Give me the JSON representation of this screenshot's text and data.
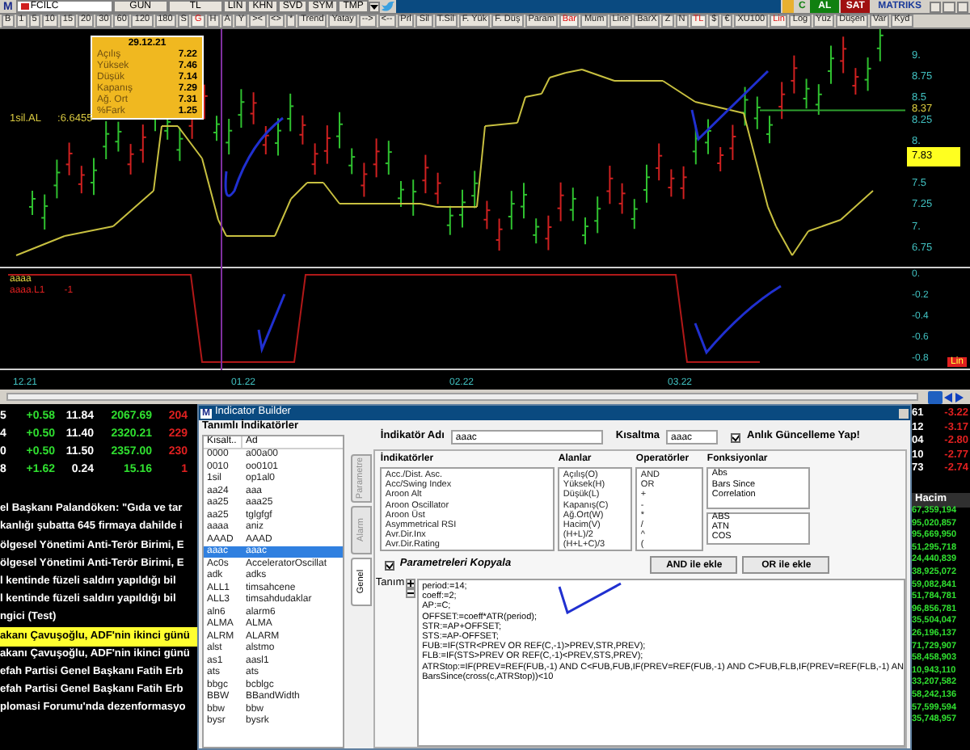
{
  "chart_window": {
    "logo": "M",
    "symbol": "FCILC",
    "top_buttons": [
      "GUN",
      "TL",
      "LIN",
      "KHN",
      "SVD",
      "SYM",
      "TMP"
    ],
    "trade_buttons": [
      {
        "label": "C",
        "kind": "neutral"
      },
      {
        "label": "AL",
        "kind": "buy"
      },
      {
        "label": "SAT",
        "kind": "sell"
      }
    ],
    "brand": "MATRIKS",
    "toolbar": [
      {
        "label": "B",
        "selected": false
      },
      {
        "label": "1",
        "selected": false
      },
      {
        "label": "5",
        "selected": false
      },
      {
        "label": "10",
        "selected": false
      },
      {
        "label": "15",
        "selected": false
      },
      {
        "label": "20",
        "selected": false
      },
      {
        "label": "30",
        "selected": false
      },
      {
        "label": "60",
        "selected": false
      },
      {
        "label": "120",
        "selected": false
      },
      {
        "label": "180",
        "selected": false
      },
      {
        "label": "S",
        "selected": false
      },
      {
        "label": "G",
        "selected": true
      },
      {
        "label": "H",
        "selected": false
      },
      {
        "label": "A",
        "selected": false
      },
      {
        "label": "Y",
        "selected": false
      },
      {
        "label": "><",
        "selected": false
      },
      {
        "label": "<>",
        "selected": false
      },
      {
        "label": "*",
        "selected": false
      },
      {
        "label": "Trend",
        "selected": false
      },
      {
        "label": "Yatay",
        "selected": false
      },
      {
        "label": "-->",
        "selected": false
      },
      {
        "label": "<--",
        "selected": false
      },
      {
        "label": "Prl",
        "selected": false
      },
      {
        "label": "Sil",
        "selected": false
      },
      {
        "label": "T.Sil",
        "selected": false
      },
      {
        "label": "F. Yük",
        "selected": false
      },
      {
        "label": "F. Düş",
        "selected": false
      },
      {
        "label": "Param",
        "selected": false
      },
      {
        "label": "Bar",
        "selected": true
      },
      {
        "label": "Mum",
        "selected": false
      },
      {
        "label": "Line",
        "selected": false
      },
      {
        "label": "BarX",
        "selected": false
      },
      {
        "label": "Z",
        "selected": false
      },
      {
        "label": "N",
        "selected": false
      },
      {
        "label": "TL",
        "selected": true
      },
      {
        "label": "$",
        "selected": false
      },
      {
        "label": "€",
        "selected": false
      },
      {
        "label": "XU100",
        "selected": false
      },
      {
        "label": "Lin",
        "selected": true
      },
      {
        "label": "Log",
        "selected": false
      },
      {
        "label": "Yüz",
        "selected": false
      },
      {
        "label": "Düşen",
        "selected": false
      },
      {
        "label": "Var",
        "selected": false
      },
      {
        "label": "Kyd",
        "selected": false
      }
    ],
    "tooltip": {
      "date": "29.12.21",
      "rows": [
        {
          "label": "Açılış",
          "value": "7.22"
        },
        {
          "label": "Yüksek",
          "value": "7.46"
        },
        {
          "label": "Düşük",
          "value": "7.14"
        },
        {
          "label": "Kapanış",
          "value": "7.29"
        },
        {
          "label": "Ağ. Ort",
          "value": "7.31"
        },
        {
          "label": "%Fark",
          "value": "1.25"
        }
      ]
    },
    "legend": {
      "label": "1sil.AL",
      "value": ":6.6455"
    },
    "price_axis": [
      "9.",
      "8.75",
      "8.5",
      "8.25",
      "8.",
      "7.5",
      "7.25",
      "7.",
      "6.75"
    ],
    "last_price": "8.37",
    "current_price": "7.83",
    "indicator_pane": {
      "legend": [
        {
          "label": "aaaa",
          "color": "#e0d040"
        },
        {
          "label": "aaaa.L1",
          "value": "-1",
          "color": "#e02020"
        }
      ],
      "axis": [
        "0.",
        "-0.2",
        "-0.4",
        "-0.6",
        "-0.8"
      ],
      "scale": "Lin"
    },
    "time_axis": [
      "12.21",
      "01.22",
      "02.22",
      "03.22"
    ]
  },
  "market_rows": [
    {
      "cells": [
        "5",
        "+0.58",
        "11.84",
        "2067.69",
        "204"
      ]
    },
    {
      "cells": [
        "4",
        "+0.50",
        "11.40",
        "2320.21",
        "229"
      ]
    },
    {
      "cells": [
        "0",
        "+0.50",
        "11.50",
        "2357.00",
        "230"
      ]
    },
    {
      "cells": [
        "8",
        "+1.62",
        "0.24",
        "15.16",
        "1"
      ]
    }
  ],
  "right_rows": [
    {
      "code": "61",
      "change": "-3.22"
    },
    {
      "code": "12",
      "change": "-3.17"
    },
    {
      "code": "04",
      "change": "-2.80"
    },
    {
      "code": "10",
      "change": "-2.77"
    },
    {
      "code": "73",
      "change": "-2.74"
    }
  ],
  "news": [
    {
      "text": "el Başkanı Palandöken: \"Gıda ve tar",
      "selected": false
    },
    {
      "text": "kanlığı şubatta 645 firmaya dahilde i",
      "selected": false
    },
    {
      "text": "ölgesel Yönetimi Anti-Terör Birimi, E",
      "selected": false
    },
    {
      "text": "ölgesel Yönetimi Anti-Terör Birimi, E",
      "selected": false
    },
    {
      "text": "l kentinde füzeli saldırı yapıldığı bil",
      "selected": false
    },
    {
      "text": "l kentinde füzeli saldırı yapıldığı bil",
      "selected": false
    },
    {
      "text": "ngici (Test)",
      "selected": false
    },
    {
      "text": "akanı Çavuşoğlu, ADF'nin ikinci günü",
      "selected": true
    },
    {
      "text": "akanı Çavuşoğlu, ADF'nin ikinci günü",
      "selected": false
    },
    {
      "text": "efah Partisi Genel Başkanı Fatih Erb",
      "selected": false
    },
    {
      "text": "efah Partisi Genel Başkanı Fatih Erb",
      "selected": false
    },
    {
      "text": "plomasi Forumu'nda dezenformasyo",
      "selected": false
    }
  ],
  "volume": {
    "header": "Hacim",
    "values": [
      "67,359,194",
      "95,020,857",
      "95,669,950",
      "51,295,718",
      "24,440,839",
      "38,925,072",
      "59,082,841",
      "51,784,781",
      "96,856,781",
      "35,504,047",
      "26,196,137",
      "71,729,907",
      "58,458,903",
      "10,943,110",
      "33,207,582",
      "58,242,136",
      "57,599,594",
      "35,748,957"
    ]
  },
  "dialog": {
    "logo": "M",
    "title": "Indicator Builder",
    "group_title": "Tanımlı İndikatörler",
    "columns": [
      "Kısalt..",
      "Ad"
    ],
    "rows": [
      {
        "code": "0000",
        "name": "a00a00",
        "selected": false
      },
      {
        "code": "0010",
        "name": "oo0101",
        "selected": false
      },
      {
        "code": "1sil",
        "name": "op1al0",
        "selected": false
      },
      {
        "code": "aa24",
        "name": "aaa",
        "selected": false
      },
      {
        "code": "aa25",
        "name": "aaa25",
        "selected": false
      },
      {
        "code": "aa25",
        "name": "tglgfgf",
        "selected": false
      },
      {
        "code": "aaaa",
        "name": "aniz",
        "selected": false
      },
      {
        "code": "AAAD",
        "name": "AAAD",
        "selected": false
      },
      {
        "code": "aaac",
        "name": "aaac",
        "selected": true
      },
      {
        "code": "Ac0s",
        "name": "AcceleratorOscillat",
        "selected": false
      },
      {
        "code": "adk",
        "name": "adks",
        "selected": false
      },
      {
        "code": "ALL1",
        "name": "timsahcene",
        "selected": false
      },
      {
        "code": "ALL3",
        "name": "timsahdudaklar",
        "selected": false
      },
      {
        "code": "aln6",
        "name": "alarm6",
        "selected": false
      },
      {
        "code": "ALMA",
        "name": "ALMA",
        "selected": false
      },
      {
        "code": "ALRM",
        "name": "ALARM",
        "selected": false
      },
      {
        "code": "alst",
        "name": "alstmo",
        "selected": false
      },
      {
        "code": "as1",
        "name": "aasl1",
        "selected": false
      },
      {
        "code": "ats",
        "name": "ats",
        "selected": false
      },
      {
        "code": "bbgc",
        "name": "bcblgc",
        "selected": false
      },
      {
        "code": "BBW",
        "name": "BBandWidth",
        "selected": false
      },
      {
        "code": "bbw",
        "name": "bbw",
        "selected": false
      },
      {
        "code": "bysr",
        "name": "bysrk",
        "selected": false
      }
    ],
    "tabs": [
      {
        "label": "Parametre",
        "selected": false
      },
      {
        "label": "Alarm",
        "selected": false
      },
      {
        "label": "Genel",
        "selected": true
      }
    ],
    "name_label": "İndikatör Adı",
    "name_value": "aaac",
    "short_label": "Kısaltma",
    "short_value": "aaac",
    "live_update": {
      "label": "Anlık Güncelleme Yap!",
      "checked": true
    },
    "lists": [
      {
        "title": "İndikatörler",
        "items": [
          "Acc./Dist. Asc.",
          "Acc/Swing Index",
          "Aroon Alt",
          "Aroon Oscillator",
          "Aroon Üst",
          "Asymmetrical RSI",
          "Avr.Dir.Inx",
          "Avr.Dir.Rating"
        ]
      },
      {
        "title": "Alanlar",
        "items": [
          "Açılış(O)",
          "Yüksek(H)",
          "Düşük(L)",
          "Kapanış(C)",
          "Ağ.Ort(W)",
          "Hacim(V)",
          "(H+L)/2",
          "(H+L+C)/3"
        ]
      },
      {
        "title": "Operatörler",
        "items": [
          "AND",
          "OR",
          "+",
          "-",
          "*",
          "/",
          "^",
          "("
        ]
      }
    ],
    "functions": {
      "title": "Fonksiyonlar",
      "items": [
        "Abs",
        "Bars Since",
        "Correlation"
      ],
      "items2": [
        "ABS",
        "ATN",
        "COS"
      ]
    },
    "copy_params": {
      "label": "Parametreleri Kopyala",
      "checked": true
    },
    "buttons": [
      "AND ile ekle",
      "OR ile ekle"
    ],
    "definition_label": "Tanım",
    "code": [
      "period:=14;",
      "coeff:=2;",
      "AP:=C;",
      "OFFSET:=coeff*ATR(period);",
      "STR:=AP+OFFSET;",
      "STS:=AP-OFFSET;",
      "FUB:=IF(STR<PREV OR REF(C,-1)>PREV,STR,PREV);",
      "FLB:=IF(STS>PREV OR REF(C,-1)<PREV,STS,PREV);",
      "ATRStop:=IF(PREV=REF(FUB,-1) AND C<FUB,FUB,IF(PREV=REF(FUB,-1) AND C>FUB,FLB,IF(PREV=REF(FLB,-1) AN",
      "BarsSince(cross(c,ATRStop))<10"
    ]
  }
}
